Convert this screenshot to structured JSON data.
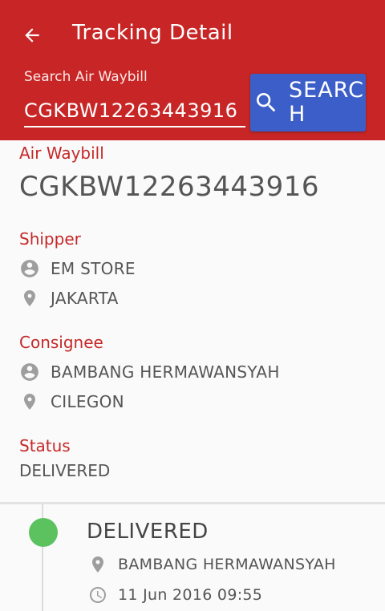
{
  "header": {
    "title": "Tracking Detail",
    "search_label": "Search Air Waybill",
    "search_value": "CGKBW12263443916",
    "search_button": "SEARCH"
  },
  "waybill": {
    "label": "Air Waybill",
    "value": "CGKBW12263443916"
  },
  "shipper": {
    "label": "Shipper",
    "name": "EM STORE",
    "city": "JAKARTA"
  },
  "consignee": {
    "label": "Consignee",
    "name": "BAMBANG HERMAWANSYAH",
    "city": "CILEGON"
  },
  "status": {
    "label": "Status",
    "value": "DELIVERED"
  },
  "timeline": [
    {
      "status": "DELIVERED",
      "receiver": "BAMBANG HERMAWANSYAH",
      "datetime": "11 Jun 2016 09:55",
      "dot_color": "#5cc15f"
    }
  ],
  "colors": {
    "appbar": "#c82626",
    "search_button": "#3b5ec8",
    "section_label": "#c62828"
  },
  "icons": [
    "back-arrow-icon",
    "search-icon",
    "person-icon",
    "location-pin-icon",
    "clock-icon"
  ]
}
